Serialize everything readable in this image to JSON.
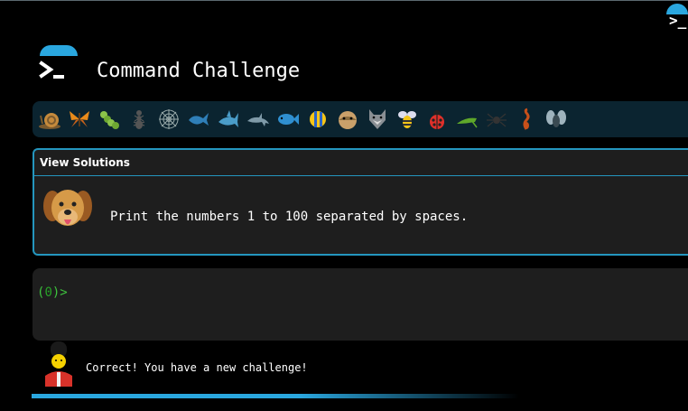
{
  "app": {
    "title": "Command Challenge",
    "logo_icon": "terminal-prompt-icon",
    "accent_color": "#2aa7df"
  },
  "creatures": [
    "snail-icon",
    "butterfly-icon",
    "caterpillar-icon",
    "ant-icon",
    "spider-web-icon",
    "whale-icon",
    "shark-icon",
    "dolphin-icon",
    "fish-icon",
    "tropical-fish-icon",
    "pufferfish-icon",
    "wolf-icon",
    "bee-icon",
    "ladybug-icon",
    "cricket-icon",
    "spider-icon",
    "scorpion-icon",
    "fly-icon"
  ],
  "challenge": {
    "header_label": "View Solutions",
    "text": "Print the numbers 1 to 100 separated by spaces.",
    "avatar": "dog-face-icon"
  },
  "terminal": {
    "prompt_open": "(",
    "prompt_count": "0",
    "prompt_close": ")>",
    "input_value": "",
    "prompt_color": "#3ec33e"
  },
  "feedback": {
    "avatar": "royal-guard-icon",
    "message": "Correct! You have a new challenge!"
  }
}
